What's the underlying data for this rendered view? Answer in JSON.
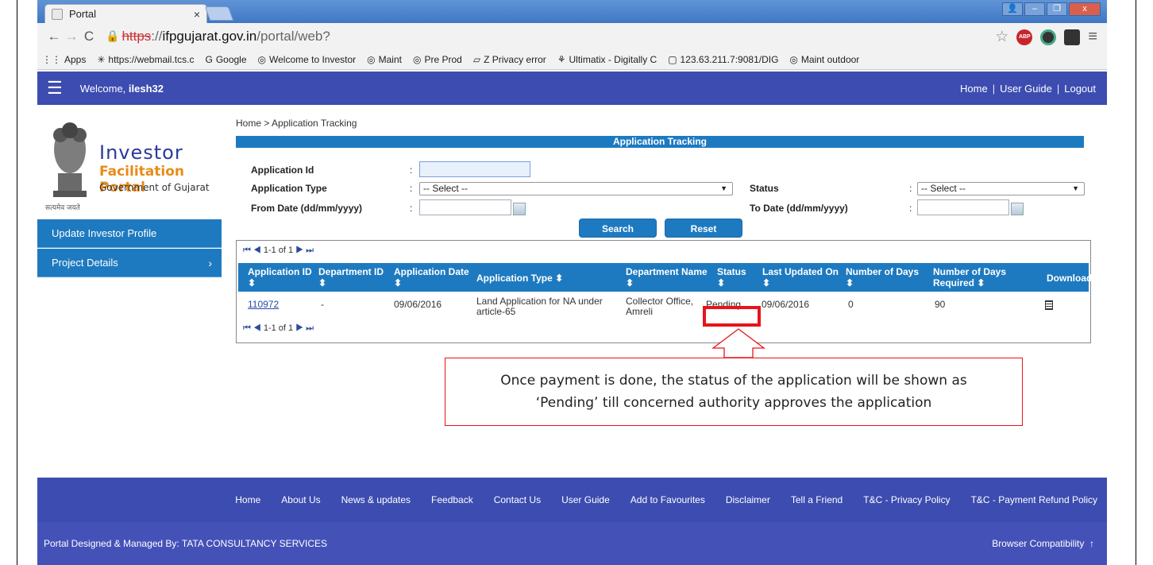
{
  "browser": {
    "tab_title": "Portal",
    "tab_close": "×",
    "url_scheme": "https",
    "url_sep": "://",
    "url_host": "ifpgujarat.gov.in",
    "url_path": "/portal/web?",
    "bookmarks": [
      {
        "icon": "⋮⋮",
        "label": "Apps"
      },
      {
        "icon": "✳",
        "label": "https://webmail.tcs.c"
      },
      {
        "icon": "G",
        "label": "Google"
      },
      {
        "icon": "◎",
        "label": "Welcome to Investor"
      },
      {
        "icon": "◎",
        "label": "Maint"
      },
      {
        "icon": "◎",
        "label": "Pre Prod"
      },
      {
        "icon": "▱",
        "label": "Z Privacy error"
      },
      {
        "icon": "⚘",
        "label": "Ultimatix - Digitally C"
      },
      {
        "icon": "▢",
        "label": "123.63.211.7:9081/DIG"
      },
      {
        "icon": "◎",
        "label": "Maint outdoor"
      }
    ],
    "abp_label": "ABP",
    "window_controls": [
      "👤",
      "–",
      "❐",
      "x"
    ]
  },
  "header": {
    "welcome_prefix": "Welcome,",
    "username": "ilesh32",
    "links": [
      "Home",
      "User Guide",
      "Logout"
    ],
    "separator": "|"
  },
  "logo": {
    "line1": "Investor",
    "line2": "Facilitation Portal",
    "line3": "Government of Gujarat",
    "motto": "सत्यमेव जयते"
  },
  "sidebar": {
    "items": [
      {
        "label": "Update Investor Profile"
      },
      {
        "label": "Project Details",
        "chevron": "›"
      }
    ]
  },
  "breadcrumb": "Home > Application Tracking",
  "form": {
    "title": "Application Tracking",
    "colon": ":",
    "fields": {
      "application_id": {
        "label": "Application Id",
        "value": ""
      },
      "application_type": {
        "label": "Application Type",
        "value": "-- Select --"
      },
      "status": {
        "label": "Status",
        "value": "-- Select --"
      },
      "from_date": {
        "label": "From Date (dd/mm/yyyy)",
        "value": ""
      },
      "to_date": {
        "label": "To Date (dd/mm/yyyy)",
        "value": ""
      }
    },
    "search_label": "Search",
    "reset_label": "Reset"
  },
  "results": {
    "pager_text": "1-1 of 1",
    "pager_icons": {
      "first": "⏮",
      "prev": "◀",
      "next": "▶",
      "last": "⏭"
    },
    "sort_icon": "⬍",
    "columns": [
      {
        "label": "Application ID"
      },
      {
        "label": "Department ID"
      },
      {
        "label": "Application Date"
      },
      {
        "label": "Application Type"
      },
      {
        "label": "Department Name"
      },
      {
        "label": "Status"
      },
      {
        "label": "Last Updated On"
      },
      {
        "label": "Number of Days"
      },
      {
        "label": "Number of Days Required"
      },
      {
        "label": "Download"
      }
    ],
    "rows": [
      {
        "application_id": "110972",
        "department_id": "-",
        "application_date": "09/06/2016",
        "application_type": "Land Application for NA under article-65",
        "department_name": "Collector Office, Amreli",
        "status": "Pending",
        "last_updated_on": "09/06/2016",
        "number_of_days": "0",
        "number_of_days_required": "90",
        "download_icon": "document-icon"
      }
    ]
  },
  "annotation": {
    "line1": "Once payment is done, the status of the application will be shown as",
    "line2": "‘Pending’ till concerned authority approves the application",
    "color": "#e8141a"
  },
  "footer": {
    "links": [
      "Home",
      "About Us",
      "News & updates",
      "Feedback",
      "Contact Us",
      "User Guide",
      "Add to Favourites",
      "Disclaimer",
      "Tell a Friend",
      "T&C - Privacy Policy",
      "T&C - Payment Refund Policy"
    ],
    "credit": "Portal Designed & Managed By: TATA CONSULTANCY SERVICES",
    "compat": "Browser Compatibility",
    "scroll_top_icon": "↑"
  },
  "colors": {
    "header_bg": "#3c4cb0",
    "accent_blue": "#1e7ac0",
    "highlight_red": "#e8141a"
  }
}
